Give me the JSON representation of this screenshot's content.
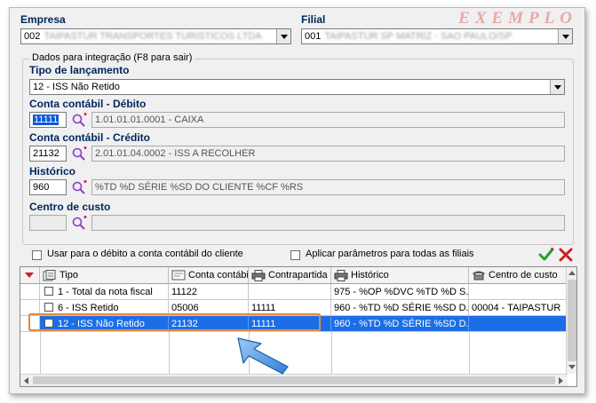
{
  "watermark": "EXEMPLO",
  "empresa": {
    "label": "Empresa",
    "code": "002",
    "name": "TAIPASTUR TRANSPORTES TURISTICOS LTDA"
  },
  "filial": {
    "label": "Filial",
    "code": "001",
    "name": "TAIPASTUR SP MATRIZ - SAO PAULO/SP"
  },
  "group_title": "Dados para integração  (F8 para sair)",
  "tipo": {
    "label": "Tipo de lançamento",
    "value": "12 - ISS Não Retido"
  },
  "debito": {
    "label": "Conta contábil - Débito",
    "code": "11111",
    "desc": "1.01.01.01.0001 - CAIXA"
  },
  "credito": {
    "label": "Conta contábil - Crédito",
    "code": "21132",
    "desc": "2.01.01.04.0002 - ISS A RECOLHER"
  },
  "historico": {
    "label": "Histórico",
    "code": "960",
    "desc": "%TD %D SÉRIE %SD DO CLIENTE %CF %RS"
  },
  "centro": {
    "label": "Centro de custo",
    "code": "",
    "desc": ""
  },
  "options": {
    "usar_debito": "Usar para o débito a conta contábil do cliente",
    "aplicar_filiais": "Aplicar parâmetros para todas as filiais"
  },
  "grid": {
    "headers": [
      "Tipo",
      "Conta contábil",
      "Contrapartida",
      "Histórico",
      "Centro de custo"
    ],
    "rows": [
      {
        "tipo": "1 - Total da nota fiscal",
        "conta": "11122",
        "contra": "",
        "hist": "975 - %OP %DVC %TD %D S...",
        "centro": ""
      },
      {
        "tipo": "6 - ISS Retido",
        "conta": "05006",
        "contra": "11111",
        "hist": "960 - %TD %D SÉRIE %SD D...",
        "centro": "00004 - TAIPASTUR"
      },
      {
        "tipo": "12 - ISS Não Retido",
        "conta": "21132",
        "contra": "11111",
        "hist": "960 - %TD %D SÉRIE %SD D...",
        "centro": ""
      }
    ]
  },
  "colors": {
    "accent": "#1d6ee6",
    "highlight": "#e58a3c",
    "arrow": "#3a8ee0",
    "confirm": "#2a9d2a",
    "cancel": "#cc2222"
  }
}
